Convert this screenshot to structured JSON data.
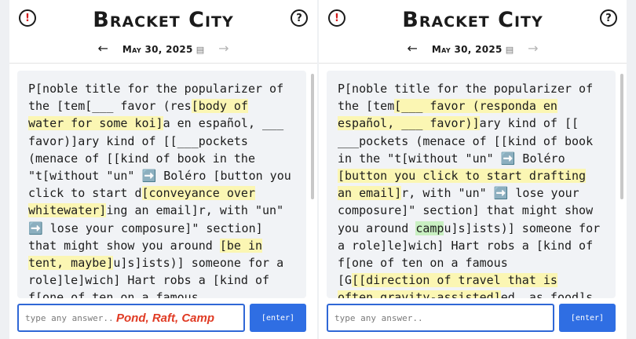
{
  "app_title": "Bracket City",
  "date": "May 30, 2025",
  "icons": {
    "alert": "exclamation-icon",
    "help": "question-icon",
    "prev": "arrow-left-icon",
    "next": "arrow-right-icon",
    "calendar": "calendar-icon"
  },
  "colors": {
    "accent": "#2f6ee3",
    "highlight": "#fbf6b3",
    "solved": "#c9f0c2",
    "overlay": "#e03b24"
  },
  "left": {
    "lines": [
      [
        {
          "t": "P[noble title for the popularizer of"
        }
      ],
      [
        {
          "t": "the [tem["
        },
        {
          "t": "___ favor (res"
        },
        {
          "t": "[body of",
          "hl": true
        }
      ],
      [
        {
          "t": "water for some koi]",
          "hl": true
        },
        {
          "t": "a en español, ___"
        }
      ],
      [
        {
          "t": "favor)]ary kind of [[___pockets"
        }
      ],
      [
        {
          "t": "(menace of [[kind of book in the"
        }
      ],
      [
        {
          "t": "\"t[without \"un\" "
        },
        {
          "t": "➡️",
          "icon": true
        },
        {
          "t": " Boléro [button you"
        }
      ],
      [
        {
          "t": "click to start d"
        },
        {
          "t": "[conveyance over",
          "hl": true
        }
      ],
      [
        {
          "t": "whitewater]",
          "hl": true
        },
        {
          "t": "ing an email]r, with \"un\""
        }
      ],
      [
        {
          "t": "➡️",
          "icon": true
        },
        {
          "t": " lose your composure]\" section]"
        }
      ],
      [
        {
          "t": "that might show you around "
        },
        {
          "t": "[be in",
          "hl": true
        }
      ],
      [
        {
          "t": "tent, maybe]",
          "hl": true
        },
        {
          "t": "u]s]ists)] someone for a"
        }
      ],
      [
        {
          "t": "role]le]wich] Hart robs a [kind of"
        }
      ],
      [
        {
          "t": "f[one of ten on a famous"
        }
      ]
    ],
    "placeholder": "type any answer...",
    "overlay_note": "Pond, Raft, Camp",
    "enter_label": "[enter]"
  },
  "right": {
    "lines": [
      [
        {
          "t": "P[noble title for the popularizer of"
        }
      ],
      [
        {
          "t": "the [tem"
        },
        {
          "t": "[___ favor (responda en",
          "hl": true
        }
      ],
      [
        {
          "t": "español, ___ favor)]",
          "hl": true
        },
        {
          "t": "ary kind of [["
        }
      ],
      [
        {
          "t": "___pockets (menace of [[kind of book"
        }
      ],
      [
        {
          "t": "in the \"t[without \"un\" "
        },
        {
          "t": "➡️",
          "icon": true
        },
        {
          "t": " Boléro"
        }
      ],
      [
        {
          "t": "[button you click to start drafting",
          "hl": true
        }
      ],
      [
        {
          "t": "an email]",
          "hl": true
        },
        {
          "t": "r, with \"un\" "
        },
        {
          "t": "➡️",
          "icon": true
        },
        {
          "t": " lose your"
        }
      ],
      [
        {
          "t": "composure]\" section] that might show"
        }
      ],
      [
        {
          "t": "you around "
        },
        {
          "t": "camp",
          "green": true
        },
        {
          "t": "u]s]ists)] someone for"
        }
      ],
      [
        {
          "t": "a role]le]wich] Hart robs a [kind of"
        }
      ],
      [
        {
          "t": "f[one of ten on a famous"
        }
      ],
      [
        {
          "t": "[G"
        },
        {
          "t": "[[direction of travel that is",
          "hl": true
        }
      ],
      [
        {
          "t": "often gravity-assisted]",
          "hl": true
        },
        {
          "t": "ed, as food]s"
        }
      ]
    ],
    "placeholder": "type any answer...",
    "enter_label": "[enter]"
  }
}
